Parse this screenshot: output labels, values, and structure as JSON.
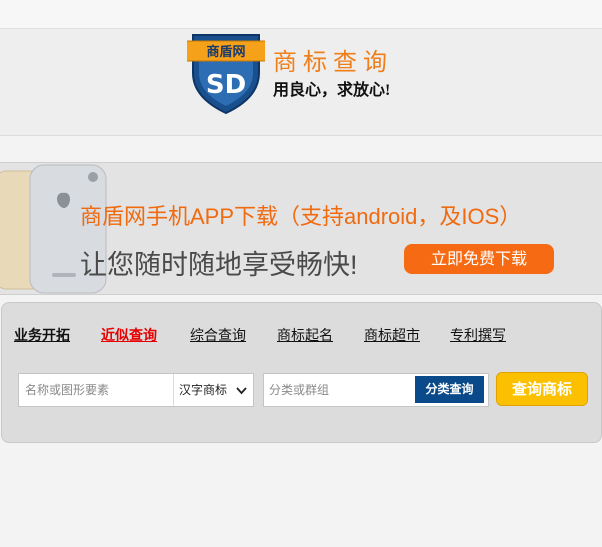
{
  "header": {
    "logo_badge_text": "商盾网",
    "logo_mark": "SD",
    "title": "商标查询",
    "slogan": "用良心，求放心!"
  },
  "banner": {
    "line1": "商盾网手机APP下载（支持android，及IOS）",
    "line2": "让您随时随地享受畅快!",
    "download_label": "立即免费下载"
  },
  "search": {
    "tabs": [
      {
        "label": "业务开拓"
      },
      {
        "label": "近似查询"
      },
      {
        "label": "综合查询"
      },
      {
        "label": "商标起名"
      },
      {
        "label": "商标超市"
      },
      {
        "label": "专利撰写"
      }
    ],
    "keyword_placeholder": "名称或图形要素",
    "type_selected": "汉字商标",
    "class_placeholder": "分类或群组",
    "class_button": "分类查询",
    "query_button": "查询商标"
  },
  "colors": {
    "brand_orange": "#f07f1a",
    "tab_active_red": "#e60000",
    "class_button_blue": "#0a4a8a",
    "query_button_yellow": "#fbc100"
  }
}
